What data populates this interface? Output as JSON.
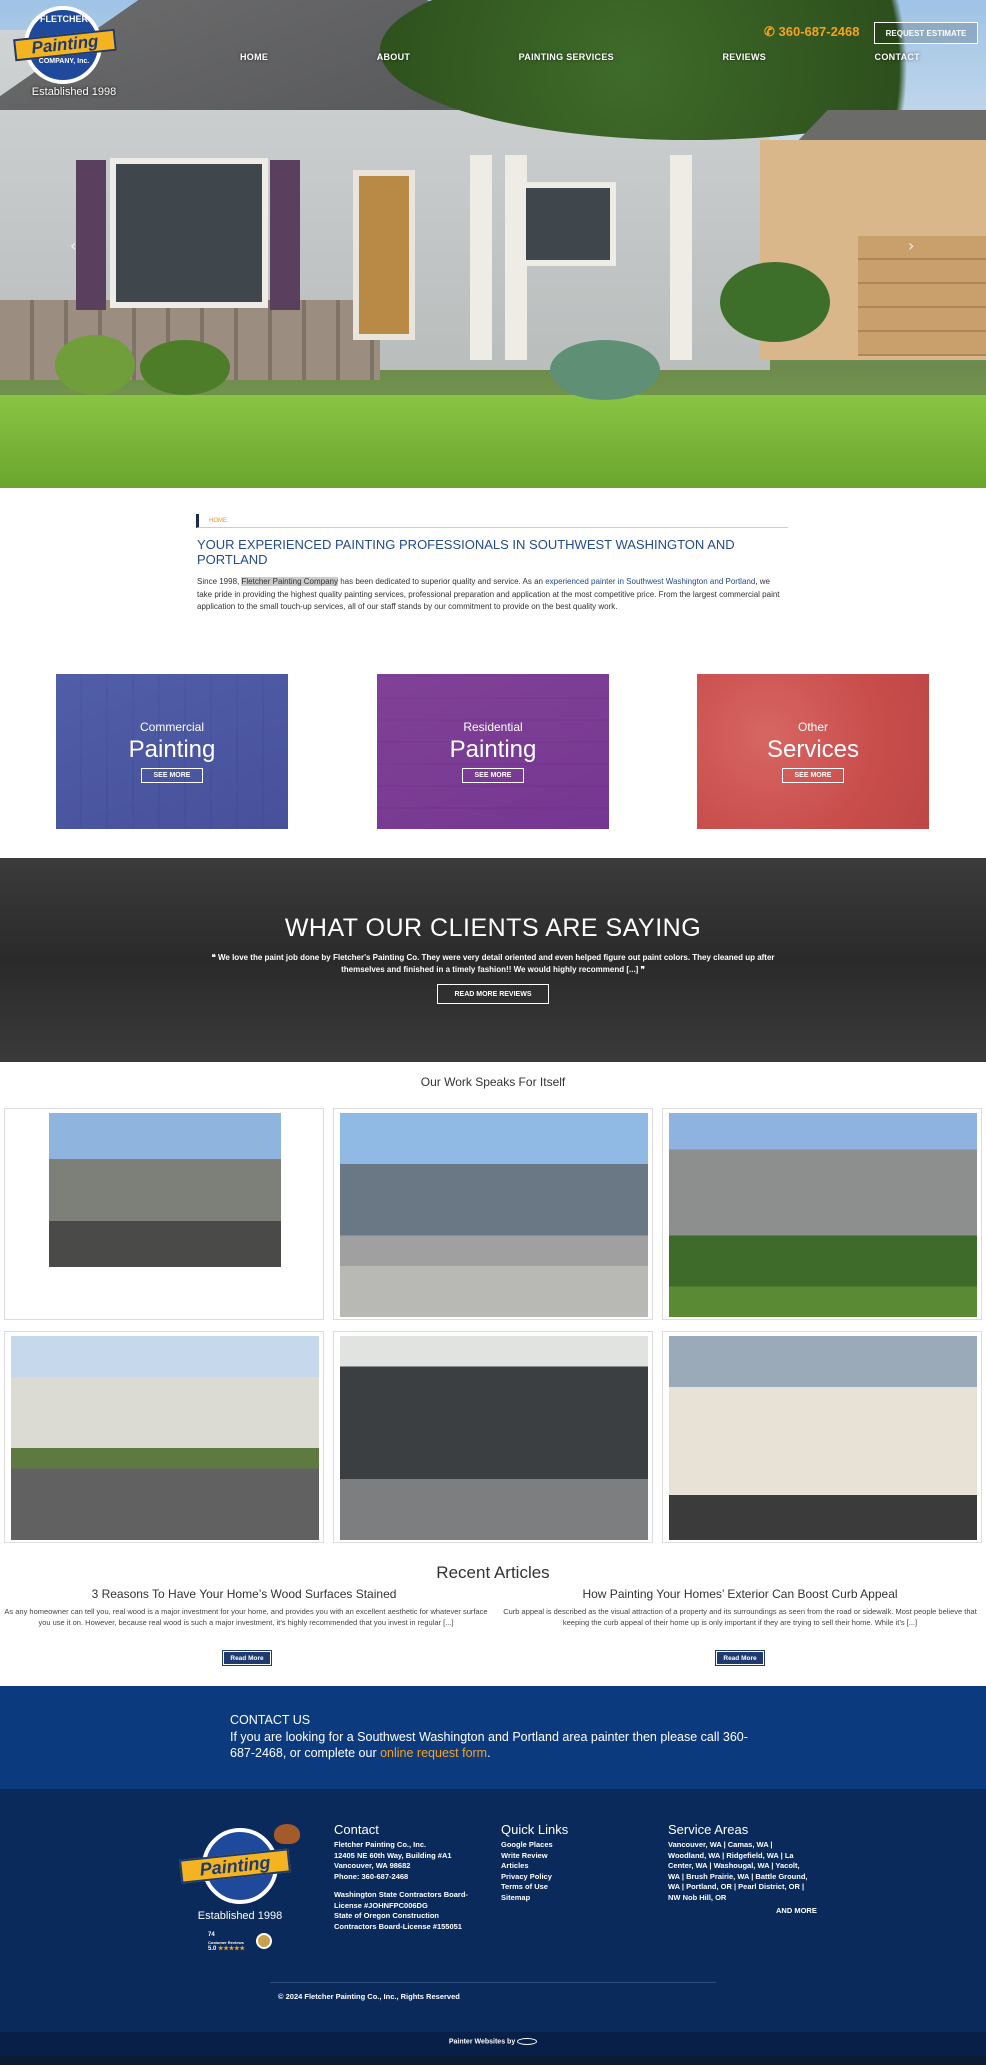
{
  "header": {
    "logo_top": "FLETCHER",
    "logo_main": "Painting",
    "logo_bottom": "COMPANY, Inc.",
    "logo_established": "Established 1998",
    "phone": "360-687-2468",
    "request_button": "REQUEST ESTIMATE",
    "nav": [
      "HOME",
      "ABOUT",
      "PAINTING SERVICES",
      "REVIEWS",
      "CONTACT"
    ]
  },
  "intro": {
    "breadcrumb": "HOME",
    "heading": "YOUR EXPERIENCED PAINTING PROFESSIONALS IN SOUTHWEST WASHINGTON AND PORTLAND",
    "p_start": "Since 1998, ",
    "p_highlight": "Fletcher Painting Company",
    "p_mid": " has been dedicated to superior quality and service. As an ",
    "p_link": "experienced painter in Southwest Washington and Portland",
    "p_end": ", we take pride in providing the highest quality painting services, professional preparation and application at the most competitive price. From the largest commercial paint application to the small touch-up services, all of our staff stands by our commitment to provide on the best quality work."
  },
  "services": [
    {
      "line1": "Commercial",
      "line2": "Painting",
      "button": "SEE MORE"
    },
    {
      "line1": "Residential",
      "line2": "Painting",
      "button": "SEE MORE"
    },
    {
      "line1": "Other",
      "line2": "Services",
      "button": "SEE MORE"
    }
  ],
  "testimonials": {
    "heading": "WHAT OUR CLIENTS ARE SAYING",
    "quote": "We love the paint job done by Fletcher's Painting Co. They were very detail oriented and even helped figure out paint colors. They cleaned up after themselves and finished in a timely fashion!! We would highly recommend [...]",
    "button": "READ MORE REVIEWS"
  },
  "gallery": {
    "heading": "Our Work Speaks For Itself"
  },
  "articles": {
    "heading": "Recent Articles",
    "items": [
      {
        "title": "3 Reasons To Have Your Home’s Wood Surfaces Stained",
        "excerpt": "As any homeowner can tell you, real wood is a major investment for your home, and provides you with an excellent aesthetic for whatever surface you use it on. However, because real wood is such a major investment, it’s highly recommended that you invest in regular [...]",
        "button": "Read More"
      },
      {
        "title": "How Painting Your Homes’ Exterior Can Boost Curb Appeal",
        "excerpt": "Curb appeal is described as the visual attraction of a property and its surroundings as seen from the road or sidewalk. Most people believe that keeping the curb appeal of their home up is only important if they are trying to sell their home. While it’s [...]",
        "button": "Read More"
      }
    ]
  },
  "contact_band": {
    "heading": "CONTACT US",
    "text": "If you are looking for a Southwest Washington and Portland area painter then please call 360-687-2468, or complete our ",
    "link": "online request form",
    "end": "."
  },
  "footer": {
    "established": "Established 1998",
    "rating_count": "74",
    "rating_label": "Customer Reviews",
    "rating_score": "5.0",
    "contact": {
      "heading": "Contact",
      "lines": [
        "Fletcher Painting Co., Inc.",
        "12405 NE 60th Way, Building #A1",
        "Vancouver, WA 98682",
        "Phone: 360-687-2468"
      ],
      "license_lines": [
        "Washington State Contractors Board-",
        "License #JOHNFPC006DG",
        "State of Oregon Construction",
        "Contractors Board-License #155051"
      ]
    },
    "quick_links": {
      "heading": "Quick Links",
      "items": [
        "Google Places",
        "Write Review",
        "Articles",
        "Privacy Policy",
        "Terms of Use",
        "Sitemap"
      ]
    },
    "service_areas": {
      "heading": "Service Areas",
      "lines": [
        "Vancouver, WA | Camas, WA |",
        "Woodland, WA | Ridgefield, WA | La",
        "Center, WA | Washougal, WA | Yacolt,",
        "WA | Brush Prairie, WA | Battle Ground,",
        "WA | Portland, OR | Pearl District, OR |",
        "NW Nob Hill, OR"
      ],
      "more": "AND MORE"
    },
    "copyright": "© 2024 Fletcher Painting Co., Inc., Rights Reserved",
    "powered": "Painter Websites by"
  },
  "colors": {
    "brand_blue": "#0b3a7e",
    "footer_navy": "#0a2a5c",
    "accent_orange": "#f7a21b",
    "heading_blue": "#244b8e",
    "tile_commercial": "#4a58a6",
    "tile_residential": "#7b3a92",
    "tile_other": "#cd5250"
  }
}
